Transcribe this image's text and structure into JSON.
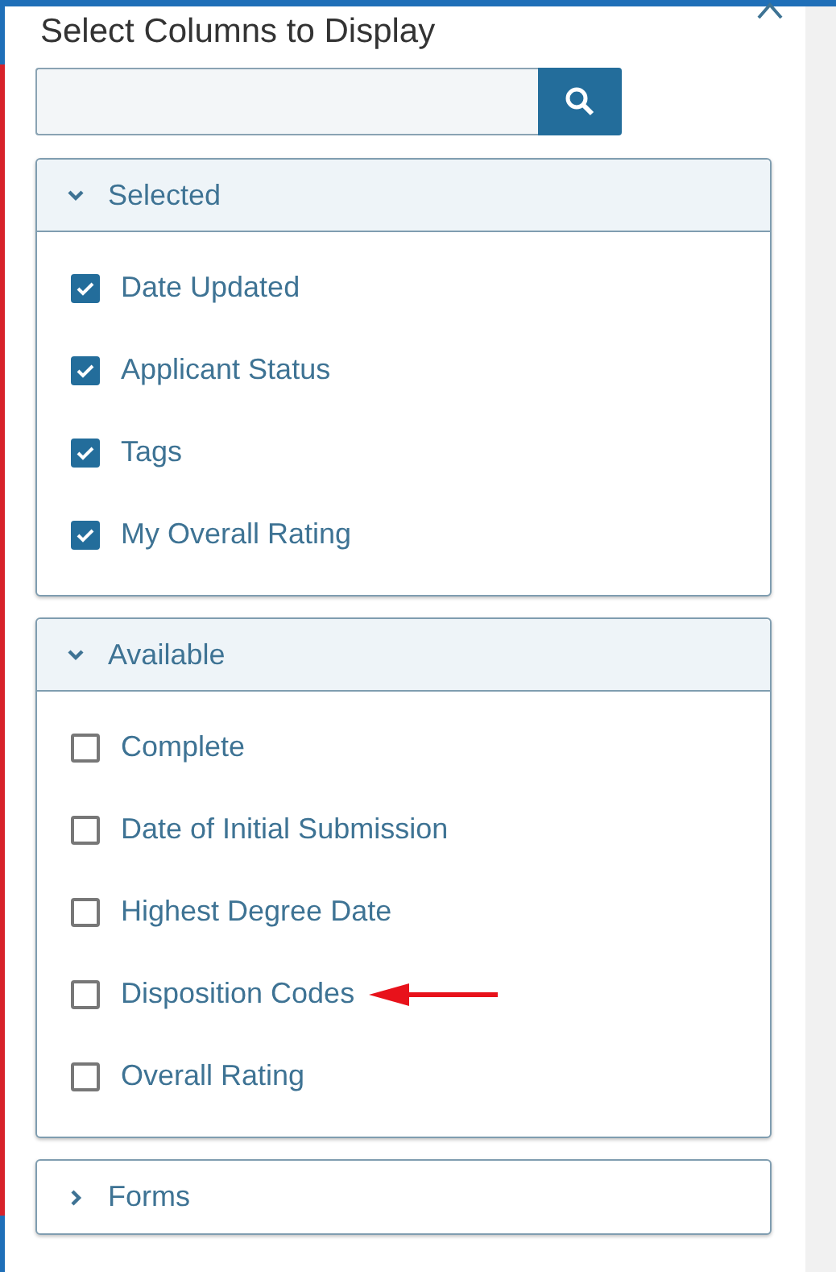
{
  "title": "Select Columns to Display",
  "sections": [
    {
      "label": "Selected",
      "expanded": true,
      "items": [
        {
          "label": "Date Updated",
          "checked": true
        },
        {
          "label": "Applicant Status",
          "checked": true
        },
        {
          "label": "Tags",
          "checked": true
        },
        {
          "label": "My Overall Rating",
          "checked": true
        }
      ]
    },
    {
      "label": "Available",
      "expanded": true,
      "items": [
        {
          "label": "Complete",
          "checked": false
        },
        {
          "label": "Date of Initial Submission",
          "checked": false
        },
        {
          "label": "Highest Degree Date",
          "checked": false
        },
        {
          "label": "Disposition Codes",
          "checked": false,
          "annotated": true
        },
        {
          "label": "Overall Rating",
          "checked": false
        }
      ]
    },
    {
      "label": "Forms",
      "expanded": false
    }
  ]
}
